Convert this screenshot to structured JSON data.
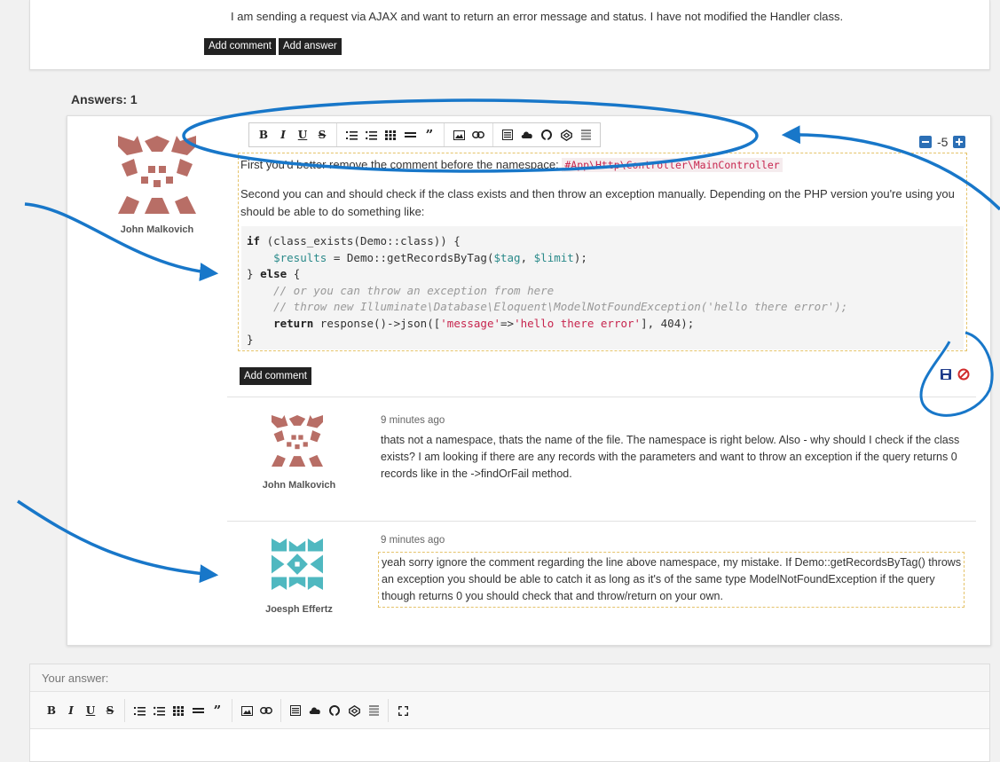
{
  "question": {
    "text": "I am sending a request via AJAX and want to return an error message and status. I have not modified the Handler class.",
    "add_comment_label": "Add comment",
    "add_answer_label": "Add answer"
  },
  "answers_heading": "Answers: 1",
  "answer": {
    "author": "John Malkovich",
    "votes": "-5",
    "para1_before": "First you'd better remove the comment before the namespace:",
    "para1_code": "#App\\Http\\Controller\\MainController",
    "para2": "Second you can and should check if the class exists and then throw an exception manually. Depending on the PHP version you're using you should be able to do something like:",
    "add_comment_label": "Add comment"
  },
  "toolbar": {
    "groups": [
      [
        {
          "icon": "bold-icon",
          "glyph": "B"
        },
        {
          "icon": "italic-icon",
          "glyph": "I"
        },
        {
          "icon": "underline-icon",
          "glyph": "U"
        },
        {
          "icon": "strikethrough-icon",
          "glyph": "S"
        }
      ],
      [
        {
          "icon": "ordered-list-icon",
          "glyph": ""
        },
        {
          "icon": "unordered-list-icon",
          "glyph": ""
        },
        {
          "icon": "table-icon",
          "glyph": ""
        },
        {
          "icon": "horizontal-rule-icon",
          "glyph": ""
        },
        {
          "icon": "quote-icon",
          "glyph": "”"
        }
      ],
      [
        {
          "icon": "image-icon",
          "glyph": ""
        },
        {
          "icon": "link-icon",
          "glyph": ""
        }
      ],
      [
        {
          "icon": "code-icon",
          "glyph": ""
        },
        {
          "icon": "cloud-icon",
          "glyph": ""
        },
        {
          "icon": "github-icon",
          "glyph": ""
        },
        {
          "icon": "codepen-icon",
          "glyph": ""
        },
        {
          "icon": "preview-icon",
          "glyph": ""
        }
      ]
    ],
    "extra_group": [
      {
        "icon": "fullscreen-icon",
        "glyph": ""
      }
    ]
  },
  "comments": [
    {
      "author": "John Malkovich",
      "time": "9 minutes ago",
      "text": "thats not a namespace, thats the name of the file. The namespace is right below. Also - why should I check if the class exists? I am looking if there are any records with the parameters and want to throw an exception if the query returns 0 records like in the ->findOrFail method."
    },
    {
      "author": "Joesph Effertz",
      "time": "9 minutes ago",
      "text": "yeah sorry ignore the comment regarding the line above namespace, my mistake. If Demo::getRecordsByTag() throws an exception you should be able to catch it as long as it's of the same type ModelNotFoundException if the query though returns 0 you should check that and throw/return on your own."
    }
  ],
  "your_answer": {
    "label": "Your answer:"
  },
  "colors": {
    "annotation_blue": "#1877c9",
    "button_dark": "#222222",
    "vote_blue": "#2c6fb5",
    "avatar_brown": "#b86e66",
    "avatar_teal": "#4fb8c0"
  }
}
